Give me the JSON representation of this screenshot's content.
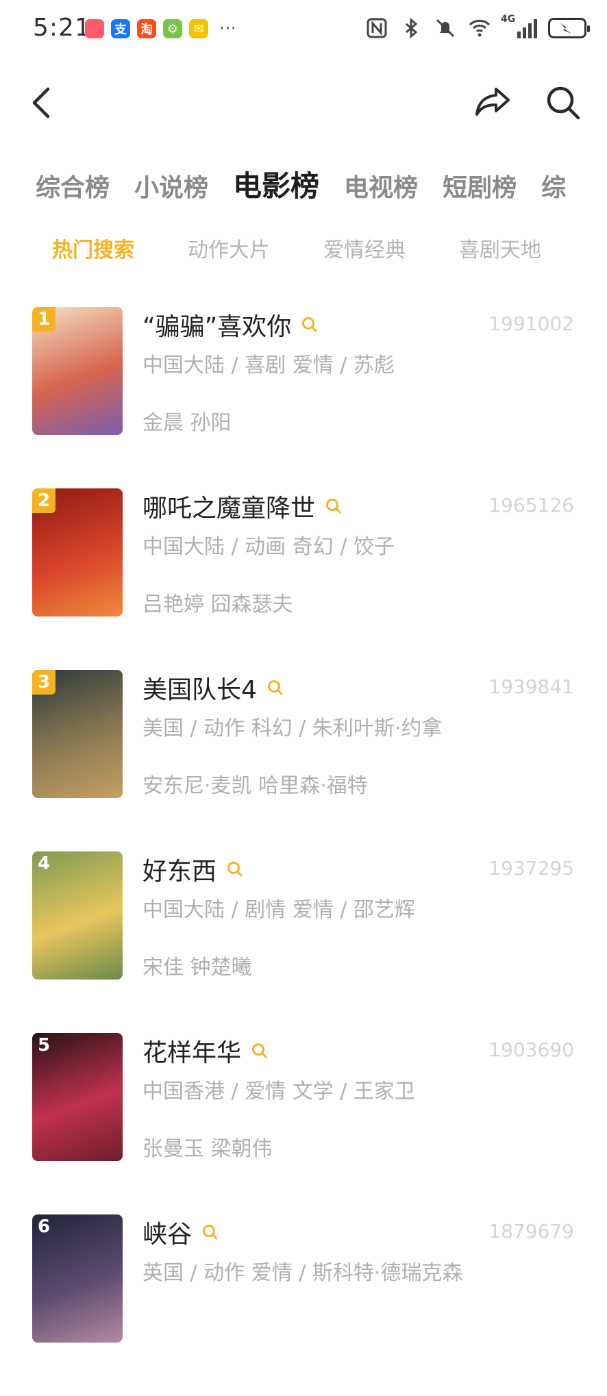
{
  "status": {
    "time": "5:21",
    "app_icons": [
      {
        "name": "red-square-app-icon",
        "color": "#ff5a6a",
        "glyph": ""
      },
      {
        "name": "alipay-app-icon",
        "color": "#1677ff",
        "glyph": "支"
      },
      {
        "name": "taobao-app-icon",
        "color": "#ff4a1a",
        "glyph": "淘"
      },
      {
        "name": "green-app-icon",
        "color": "#7bc44a",
        "glyph": "⚙"
      },
      {
        "name": "mail-app-icon",
        "color": "#f5c400",
        "glyph": "✉"
      }
    ],
    "more": "···",
    "network": "4G"
  },
  "tabs": [
    {
      "label": "综合榜",
      "active": false
    },
    {
      "label": "小说榜",
      "active": false
    },
    {
      "label": "电影榜",
      "active": true
    },
    {
      "label": "电视榜",
      "active": false
    },
    {
      "label": "短剧榜",
      "active": false
    },
    {
      "label": "综",
      "active": false
    }
  ],
  "subtabs": [
    {
      "label": "热门搜索",
      "active": true
    },
    {
      "label": "动作大片",
      "active": false
    },
    {
      "label": "爱情经典",
      "active": false
    },
    {
      "label": "喜剧天地",
      "active": false
    }
  ],
  "colors": {
    "accent": "#f5b323",
    "muted": "#b0b0b0",
    "score": "#d4d4d4"
  },
  "movies": [
    {
      "rank": "1",
      "title": "“骗骗”喜欢你",
      "score": "1991002",
      "meta": "中国大陆 / 喜剧 爱情 / 苏彪",
      "cast": "金晨 孙阳",
      "poster_colors": [
        "#f3e1c4",
        "#d7644e",
        "#7a5fb0"
      ],
      "rank_style": "gold"
    },
    {
      "rank": "2",
      "title": "哪吒之魔童降世",
      "score": "1965126",
      "meta": "中国大陆 / 动画 奇幻 / 饺子",
      "cast": "吕艳婷 囧森瑟夫",
      "poster_colors": [
        "#8e1a12",
        "#d8432a",
        "#f08a3c"
      ],
      "rank_style": "gold"
    },
    {
      "rank": "3",
      "title": "美国队长4",
      "score": "1939841",
      "meta": "美国 / 动作 科幻 / 朱利叶斯·约拿",
      "cast": "安东尼·麦凯 哈里森·福特",
      "poster_colors": [
        "#2d3a3a",
        "#8a7a52",
        "#c7a063"
      ],
      "rank_style": "gold"
    },
    {
      "rank": "4",
      "title": "好东西",
      "score": "1937295",
      "meta": "中国大陆 / 剧情 爱情 / 邵艺辉",
      "cast": "宋佳 钟楚曦",
      "poster_colors": [
        "#7f9a52",
        "#e8c65e",
        "#6a8a4a"
      ],
      "rank_style": "dark"
    },
    {
      "rank": "5",
      "title": "花样年华",
      "score": "1903690",
      "meta": "中国香港 / 爱情 文学 / 王家卫",
      "cast": "张曼玉 梁朝伟",
      "poster_colors": [
        "#2a1216",
        "#c0314f",
        "#6d1e2a"
      ],
      "rank_style": "dark"
    },
    {
      "rank": "6",
      "title": "峡谷",
      "score": "1879679",
      "meta": "英国 / 动作 爱情 / 斯科特·德瑞克森",
      "cast": "",
      "poster_colors": [
        "#22243a",
        "#5b4c6e",
        "#b48aa0"
      ],
      "rank_style": "dark"
    }
  ]
}
